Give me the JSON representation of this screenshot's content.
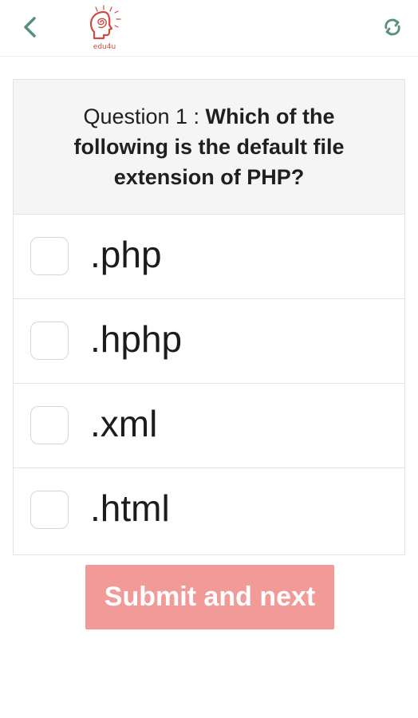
{
  "header": {
    "back_icon": "chevron-left-icon",
    "logo_text": "edu4u",
    "refresh_icon": "refresh-icon",
    "icon_color": "#5a8f7b"
  },
  "question": {
    "prefix": "Question 1 : ",
    "text": "Which of the following is the default file extension of PHP?"
  },
  "options": [
    {
      "label": ".php",
      "checked": false
    },
    {
      "label": ".hphp",
      "checked": false
    },
    {
      "label": ".xml",
      "checked": false
    },
    {
      "label": ".html",
      "checked": false
    }
  ],
  "submit": {
    "label": "Submit and next",
    "color": "#f19a98"
  }
}
